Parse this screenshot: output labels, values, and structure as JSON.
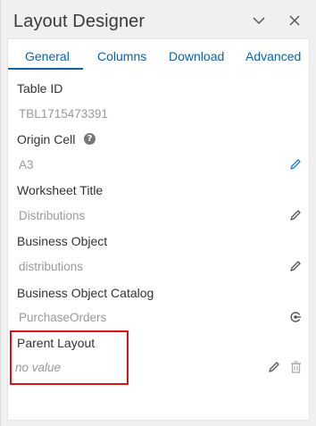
{
  "window": {
    "title": "Layout Designer",
    "collapse_icon": "chevron-down-icon",
    "close_icon": "close-icon"
  },
  "tabs": [
    {
      "label": "General",
      "active": true
    },
    {
      "label": "Columns",
      "active": false
    },
    {
      "label": "Download",
      "active": false
    },
    {
      "label": "Advanced",
      "active": false
    }
  ],
  "fields": {
    "table_id": {
      "label": "Table ID",
      "value": "TBL1715473391"
    },
    "origin_cell": {
      "label": "Origin Cell",
      "value": "A3",
      "help_glyph": "?"
    },
    "worksheet_title": {
      "label": "Worksheet Title",
      "value": "Distributions"
    },
    "business_object": {
      "label": "Business Object",
      "value": "distributions"
    },
    "business_object_catalog": {
      "label": "Business Object Catalog",
      "value": "PurchaseOrders"
    },
    "parent_layout": {
      "label": "Parent Layout",
      "value": "no value"
    }
  },
  "colors": {
    "accent": "#0b64a8",
    "highlight": "#d9121b",
    "edit_blue": "#1f7fd1"
  }
}
